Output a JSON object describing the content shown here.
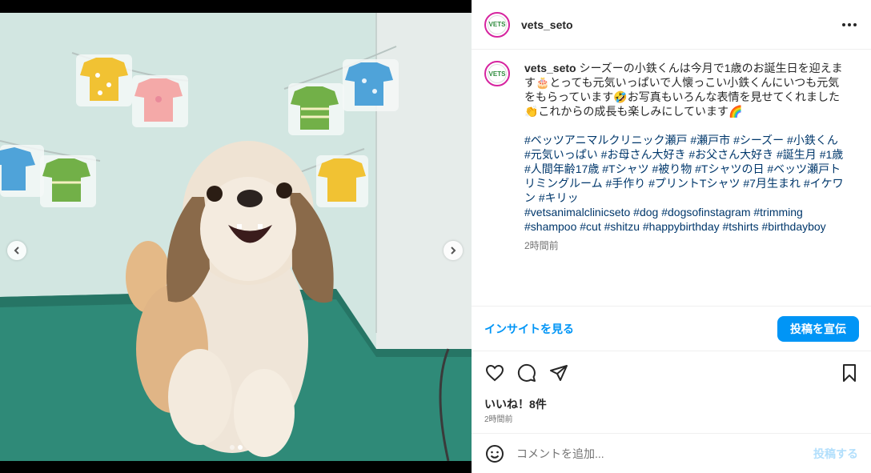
{
  "post": {
    "username": "vets_seto",
    "avatar_text": "VETS",
    "caption_user": "vets_seto",
    "caption_text": "シーズーの小鉄くんは今月で1歳のお誕生日を迎えます🎂とっても元気いっぱいで人懐っこい小鉄くんにいつも元気をもらっています🤣お写真もいろんな表情を見せてくれました👏これからの成長も楽しみにしています🌈",
    "hashtags_jp": "#ベッツアニマルクリニック瀬戸 #瀬戸市 #シーズー #小鉄くん #元気いっぱい #お母さん大好き #お父さん大好き #誕生月 #1歳 #人間年齢17歳 #Tシャツ #被り物 #Tシャツの日 #ベッツ瀬戸トリミングルーム #手作り #プリントTシャツ #7月生まれ #イケワン #キリッ",
    "hashtags_en": "#vetsanimalclinicseto #dog #dogsofinstagram #trimming #shampoo #cut #shitzu #happybirthday #tshirts #birthdayboy",
    "caption_time": "2時間前"
  },
  "insights": {
    "link": "インサイトを見る",
    "promote": "投稿を宣伝"
  },
  "engagement": {
    "likes": "いいね！8件",
    "time": "2時間前"
  },
  "comment": {
    "placeholder": "コメントを追加...",
    "post": "投稿する"
  },
  "carousel": {
    "dot_count": 2,
    "active_index": 1
  },
  "icons": {
    "more": "more-horizontal-icon",
    "like": "heart-icon",
    "comment": "comment-icon",
    "share": "share-icon",
    "save": "bookmark-icon",
    "emoji": "emoji-icon",
    "prev": "chevron-left-icon",
    "next": "chevron-right-icon"
  },
  "colors": {
    "accent": "#0095f6",
    "hashtag": "#00376b",
    "muted": "#737373"
  }
}
